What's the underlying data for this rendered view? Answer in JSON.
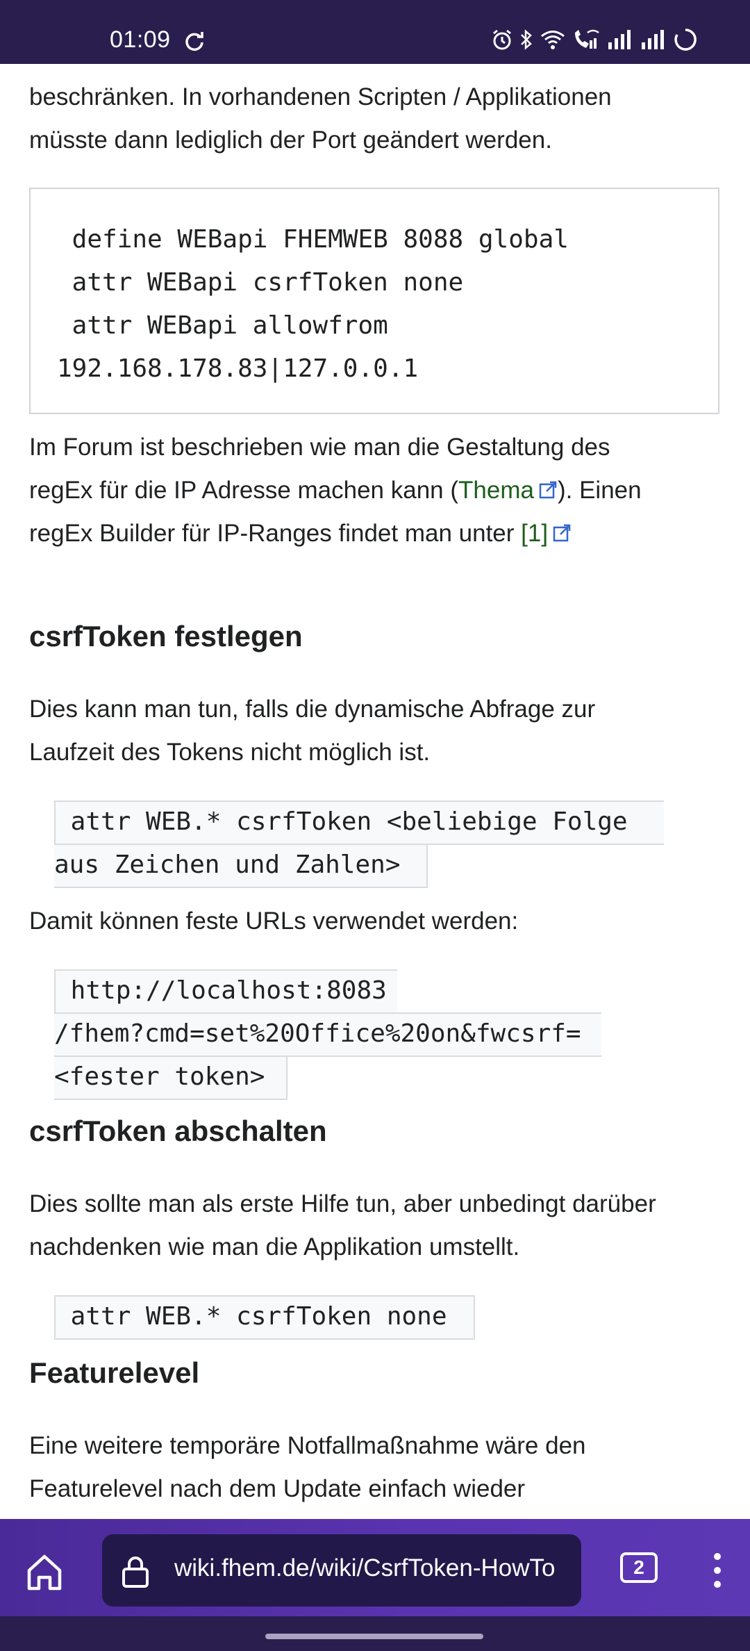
{
  "status_bar": {
    "time": "01:09",
    "icons": [
      "sync-icon",
      "alarm-icon",
      "bluetooth-icon",
      "wifi-icon",
      "wifi-call-icon",
      "signal-icon",
      "signal-icon",
      "battery-loading-icon"
    ]
  },
  "article": {
    "intro_lines": [
      "beschränken. In vorhandenen Scripten / Applikationen",
      "müsste dann lediglich der Port geändert werden."
    ],
    "code_block_1": " define WEBapi FHEMWEB 8088 global\n attr WEBapi csrfToken none\n attr WEBapi allowfrom\n192.168.178.83|127.0.0.1",
    "forum": {
      "line1": "Im Forum ist beschrieben wie man die Gestaltung des",
      "line2_before": "regEx für die IP Adresse machen kann (",
      "line2_link": "Thema",
      "line2_after": "). Einen",
      "line3_before": "regEx Builder für IP-Ranges findet man unter ",
      "line3_link": "[1]"
    },
    "section_csrf_set": {
      "heading": "csrfToken festlegen",
      "para_lines": [
        "Dies kann man tun, falls die dynamische Abfrage zur",
        "Laufzeit des Tokens nicht möglich ist."
      ],
      "code_lines": [
        " attr WEB.* csrfToken <beliebige Folge",
        "aus Zeichen und Zahlen> "
      ],
      "urls_text": "Damit können feste URLs verwendet werden:",
      "url_code_lines": [
        " http://localhost:8083",
        "/fhem?cmd=set%20Office%20on&fwcsrf=",
        "<fester token> "
      ]
    },
    "section_csrf_off": {
      "heading": "csrfToken abschalten",
      "para_lines": [
        "Dies sollte man als erste Hilfe tun, aber unbedingt darüber",
        "nachdenken wie man die Applikation umstellt."
      ],
      "code_line": " attr WEB.* csrfToken none "
    },
    "section_feature": {
      "heading": "Featurelevel",
      "para_lines": [
        "Eine weitere temporäre Notfallmaßnahme wäre den",
        "Featurelevel nach dem Update einfach wieder"
      ]
    }
  },
  "browser_bar": {
    "url": "wiki.fhem.de/wiki/CsrfToken-HowTo",
    "tab_count": "2",
    "accent_color": "#5a33b0"
  }
}
